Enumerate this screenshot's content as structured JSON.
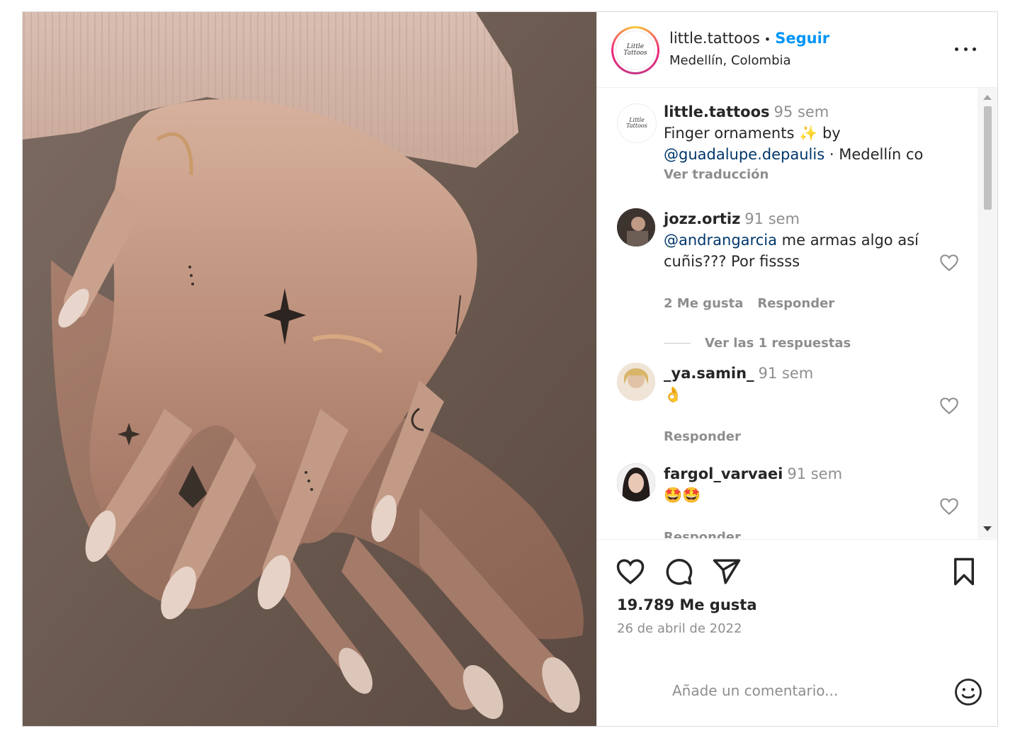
{
  "post": {
    "username": "little.tattoos",
    "follow_label": "Seguir",
    "location": "Medellín, Colombia",
    "logo_text": [
      "Little",
      "Tattoos"
    ]
  },
  "caption": {
    "username": "little.tattoos",
    "time": "95 sem",
    "text_1": "Finger ornaments",
    "emoji": "✨",
    "text_2": "by",
    "mention": "@guadalupe.depaulis",
    "text_3": "· Medellín co",
    "translate_label": "Ver traducción"
  },
  "comments": [
    {
      "username": "jozz.ortiz",
      "time": "91 sem",
      "mention": "@andrangarcia",
      "text_line1": "me armas algo así",
      "text_line2": "cuñis??? Por fissss",
      "likes_label": "2 Me gusta",
      "reply_label": "Responder",
      "view_replies": "Ver las 1 respuestas"
    },
    {
      "username": "_ya.samin_",
      "time": "91 sem",
      "text": "👌",
      "reply_label": "Responder"
    },
    {
      "username": "fargol_varvaei",
      "time": "91 sem",
      "text": "🤩🤩",
      "reply_label": "Responder"
    }
  ],
  "footer": {
    "likes": "19.789 Me gusta",
    "date": "26 de abril de 2022",
    "comment_placeholder": "Añade un comentario..."
  },
  "icons": {
    "more": "more-options-icon",
    "like": "heart-icon",
    "comment": "comment-icon",
    "share": "share-icon",
    "save": "bookmark-icon",
    "emoji": "emoji-icon"
  },
  "colors": {
    "follow_blue": "#0095f6",
    "mention_blue": "#00376b",
    "muted_gray": "#8e8e8e"
  }
}
